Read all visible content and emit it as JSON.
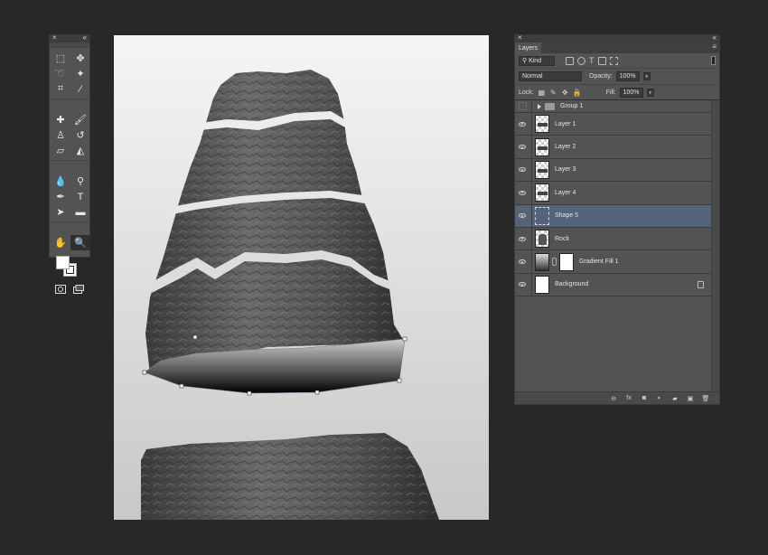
{
  "tools_panel": {
    "close_glyph": "×",
    "collapse_glyph": "«",
    "tools": [
      {
        "name": "marquee-icon",
        "glyph": "⬚"
      },
      {
        "name": "move-icon",
        "glyph": "✥"
      },
      {
        "name": "lasso-icon",
        "glyph": "➰"
      },
      {
        "name": "magic-wand-icon",
        "glyph": "✦"
      },
      {
        "name": "crop-icon",
        "glyph": "⌗"
      },
      {
        "name": "eyedropper-icon",
        "glyph": "⁄"
      },
      {
        "name": "healing-brush-icon",
        "glyph": "✚"
      },
      {
        "name": "brush-icon",
        "glyph": "🖌"
      },
      {
        "name": "clone-stamp-icon",
        "glyph": "♙"
      },
      {
        "name": "history-brush-icon",
        "glyph": "↺"
      },
      {
        "name": "eraser-icon",
        "glyph": "▱"
      },
      {
        "name": "paint-bucket-icon",
        "glyph": "◭"
      },
      {
        "name": "blur-icon",
        "glyph": "💧"
      },
      {
        "name": "dodge-icon",
        "glyph": "⚲"
      },
      {
        "name": "pen-icon",
        "glyph": "✒"
      },
      {
        "name": "type-icon",
        "glyph": "T"
      },
      {
        "name": "path-selection-icon",
        "glyph": "➤"
      },
      {
        "name": "rectangle-icon",
        "glyph": "▬"
      },
      {
        "name": "hand-icon",
        "glyph": "✋"
      },
      {
        "name": "zoom-icon",
        "glyph": "🔍"
      }
    ]
  },
  "layers_panel": {
    "tab_label": "Layers",
    "menu_glyph": "≡",
    "filter_label": "Kind",
    "blend_mode": "Normal",
    "opacity_label": "Opacity:",
    "opacity_value": "100%",
    "lock_label": "Lock:",
    "fill_label": "Fill:",
    "fill_value": "100%",
    "layers": [
      {
        "name": "Group 1",
        "type": "group",
        "visible": false,
        "selected": false
      },
      {
        "name": "Layer 1",
        "type": "band",
        "visible": true,
        "selected": false
      },
      {
        "name": "Layer 2",
        "type": "band",
        "visible": true,
        "selected": false
      },
      {
        "name": "Layer 3",
        "type": "band",
        "visible": true,
        "selected": false
      },
      {
        "name": "Layer 4",
        "type": "band",
        "visible": true,
        "selected": false
      },
      {
        "name": "Shape 5",
        "type": "shape",
        "visible": true,
        "selected": true
      },
      {
        "name": "Rock",
        "type": "rock",
        "visible": true,
        "selected": false
      },
      {
        "name": "Gradient Fill 1",
        "type": "gradient",
        "visible": true,
        "selected": false
      },
      {
        "name": "Background",
        "type": "background",
        "visible": true,
        "selected": false,
        "locked": true
      }
    ],
    "footer_buttons": [
      {
        "name": "link-layers-icon",
        "glyph": "⊖"
      },
      {
        "name": "fx-icon",
        "glyph": "fx"
      },
      {
        "name": "add-mask-icon",
        "glyph": "◙"
      },
      {
        "name": "adjustment-layer-icon",
        "glyph": "◐"
      },
      {
        "name": "new-group-icon",
        "glyph": "▰"
      },
      {
        "name": "new-layer-icon",
        "glyph": "▣"
      },
      {
        "name": "delete-layer-icon",
        "glyph": "🗑"
      }
    ]
  }
}
